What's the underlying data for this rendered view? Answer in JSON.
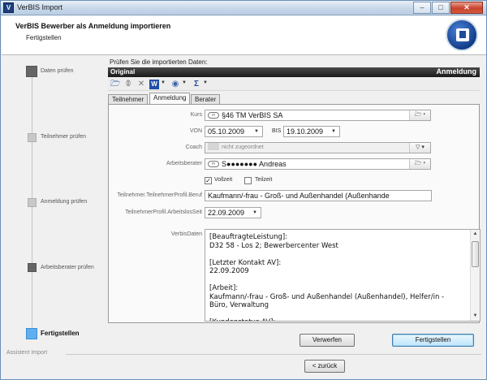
{
  "window": {
    "title": "VerBIS Import",
    "app_icon": "app-icon",
    "buttons": {
      "minimize": "–",
      "maximize": "□",
      "close": "✕"
    }
  },
  "header": {
    "title": "VerBIS Bewerber als Anmeldung importieren",
    "subtitle": "Fertigstellen",
    "logo": "verbis-logo"
  },
  "steps": [
    {
      "label": "Daten prüfen",
      "state": "done"
    },
    {
      "label": "Teilnehmer prüfen",
      "state": "pending"
    },
    {
      "label": "Anmeldung prüfen",
      "state": "pending"
    },
    {
      "label": "Arbeitsberater prüfen",
      "state": "done"
    },
    {
      "label": "Fertigstellen",
      "state": "current"
    }
  ],
  "content": {
    "intro": "Prüfen Sie die importierten Daten:",
    "panel": {
      "left": "Original",
      "right": "Anmeldung"
    },
    "toolbar": [
      "folder-open-icon",
      "paperclip-icon",
      "delete-icon",
      "word-icon",
      "globe-icon",
      "sum-icon"
    ],
    "tabs": [
      {
        "label": "Teilnehmer",
        "active": false
      },
      {
        "label": "Anmeldung",
        "active": true
      },
      {
        "label": "Berater",
        "active": false
      }
    ],
    "form": {
      "kurs_label": "Kurs",
      "kurs_value": "§46 TM VerBIS SA",
      "von_label": "VON",
      "von_value": "05.10.2009",
      "bis_label": "BIS",
      "bis_value": "19.10.2009",
      "coach_label": "Coach",
      "coach_value": "nicht zugeordnet",
      "berater_label": "Arbeitsberater",
      "berater_value": "S●●●●●●● Andreas",
      "vollzeit_label": "Vollzeit",
      "vollzeit_checked": true,
      "teilzeit_label": "Teilzeit",
      "teilzeit_checked": false,
      "beruf_label": "Teilnehmer.TeilnehmerProfil.Beruf",
      "beruf_value": "Kaufmann/-frau - Groß- und Außenhandel (Außenhande",
      "arbeitslos_label": "TeilnehmerProfil.ArbeitslosSeit",
      "arbeitslos_value": "22.09.2009",
      "verbis_label": "VerbisDaten",
      "verbis_text": "[BeauftragteLeistung]:\nD32 58 - Los 2; Bewerbercenter West\n\n[Letzter Kontakt AV]:\n22.09.2009\n\n[Arbeit]:\nKaufmann/-frau - Groß- und Außenhandel (Außenhandel), Helfer/in -\nBüro, Verwaltung\n\n[Kundenstatus AV]:"
    },
    "buttons": {
      "discard": "Verwerfen",
      "finish": "Fertigstellen"
    }
  },
  "footer": {
    "label": "Assistent Import",
    "back": "< zurück"
  }
}
